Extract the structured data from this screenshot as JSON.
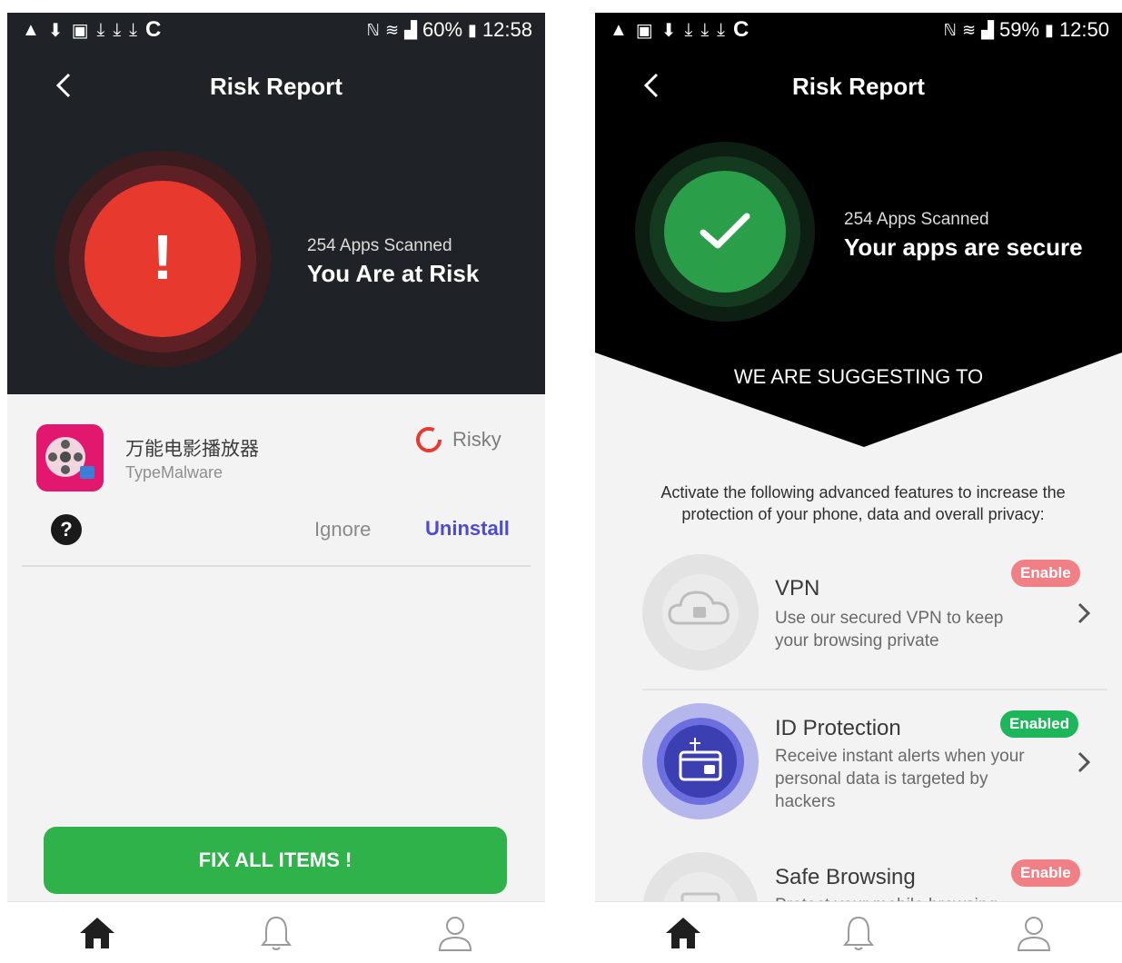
{
  "left": {
    "statusbar": {
      "battery": "60%",
      "time": "12:58"
    },
    "title": "Risk Report",
    "summary": {
      "scan_count": "254 Apps Scanned",
      "status": "You Are at Risk",
      "alert_glyph": "!"
    },
    "app": {
      "name": "万能电影播放器",
      "type": "TypeMalware",
      "risk_label": "Risky"
    },
    "actions": {
      "help_glyph": "?",
      "ignore": "Ignore",
      "uninstall": "Uninstall"
    },
    "fix_button": "FIX ALL ITEMS !",
    "colors": {
      "header": "#1f2327",
      "danger": "#e8392f",
      "accent": "#4e4bd3",
      "success": "#2fb24a"
    }
  },
  "right": {
    "statusbar": {
      "battery": "59%",
      "time": "12:50"
    },
    "title": "Risk Report",
    "summary": {
      "scan_count": "254 Apps Scanned",
      "status": "Your apps are secure"
    },
    "suggest_title": "WE ARE SUGGESTING TO",
    "intro": "Activate the following advanced features to increase the protection of your phone, data and overall privacy:",
    "features": [
      {
        "title": "VPN",
        "desc": "Use our secured VPN to keep your browsing private",
        "badge": "Enable",
        "icon": "cloud-lock-icon"
      },
      {
        "title": "ID Protection",
        "desc": "Receive instant alerts when your personal data is targeted by hackers",
        "badge": "Enabled",
        "icon": "id-card-icon"
      },
      {
        "title": "Safe Browsing",
        "desc": "Protect your mobile browsing",
        "badge": "Enable",
        "icon": "globe-icon"
      }
    ],
    "colors": {
      "header": "#000000",
      "secure": "#2a9e48",
      "enable_badge": "#f07f86",
      "enabled_badge": "#1eb65a",
      "id_icon": "#6c6ee0"
    }
  },
  "nav": {
    "home": "home-icon",
    "notifications": "bell-icon",
    "profile": "user-icon"
  }
}
